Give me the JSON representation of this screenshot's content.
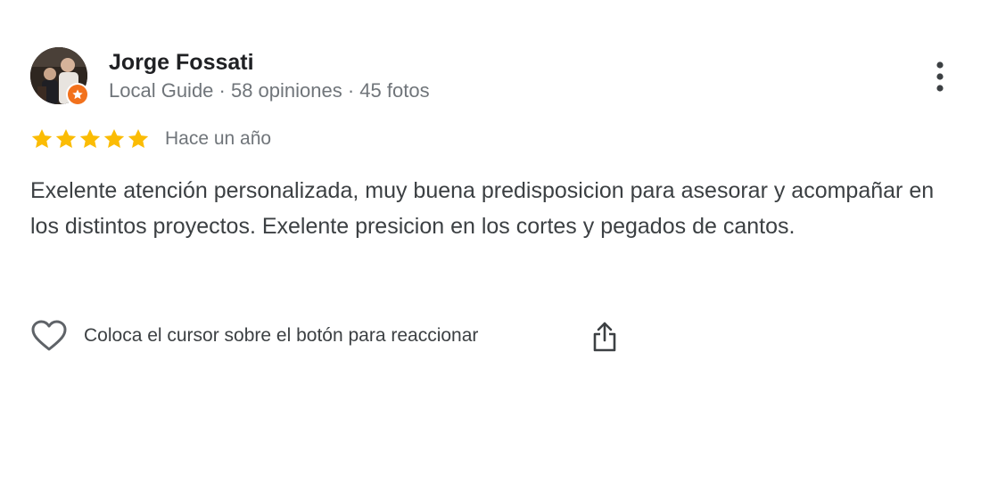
{
  "review": {
    "author": {
      "name": "Jorge Fossati",
      "meta": "Local Guide · 58 opiniones · 45 fotos",
      "badge_color": "#f2711c"
    },
    "rating": {
      "stars": 5,
      "max": 5,
      "star_color": "#fbbc04"
    },
    "date": "Hace un año",
    "text": "Exelente atención personalizada, muy buena predisposicion para asesorar y acompañar en los distintos proyectos. Exelente presicion en los cortes y pegados de cantos.",
    "actions": {
      "react_hint": "Coloca el cursor sobre el botón para reaccionar",
      "like_icon": "heart-outline-icon",
      "share_icon": "share-icon",
      "more_icon": "more-vertical-icon"
    }
  }
}
